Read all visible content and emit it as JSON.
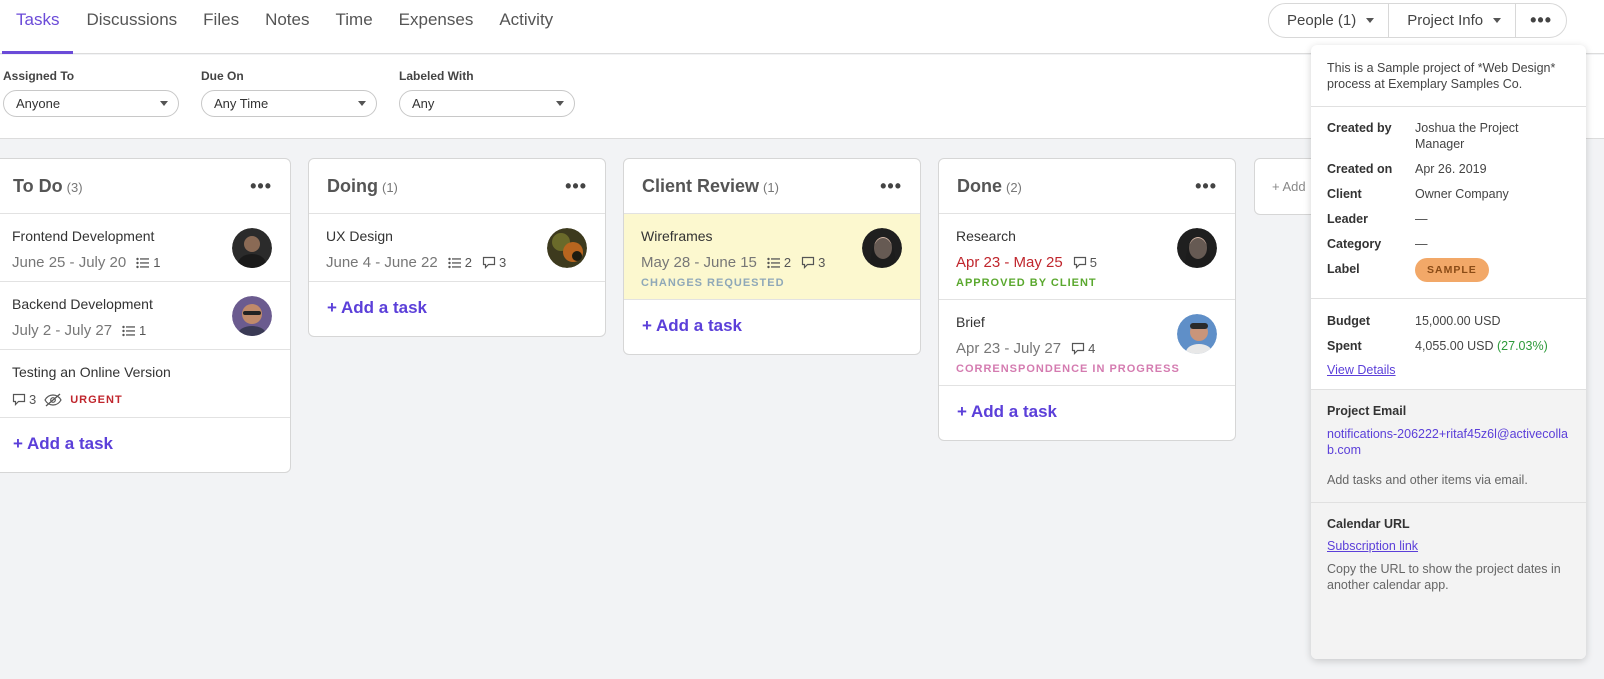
{
  "tabs": [
    "Tasks",
    "Discussions",
    "Files",
    "Notes",
    "Time",
    "Expenses",
    "Activity"
  ],
  "header": {
    "people_label": "People (1)",
    "project_info_label": "Project Info",
    "more_label": "•••"
  },
  "filters": [
    {
      "label": "Assigned To",
      "value": "Anyone"
    },
    {
      "label": "Due On",
      "value": "Any Time"
    },
    {
      "label": "Labeled With",
      "value": "Any"
    }
  ],
  "columns": {
    "todo": {
      "title": "To Do",
      "count": "(3)",
      "dots": "•••",
      "add": "+ Add a task",
      "tasks": [
        {
          "name": "Frontend Development",
          "date": "June 25 - July 20",
          "subtasks": "1"
        },
        {
          "name": "Backend Development",
          "date": "July 2 - July 27",
          "subtasks": "1"
        },
        {
          "name": "Testing an Online Version",
          "comments": "3",
          "tag": "URGENT"
        }
      ]
    },
    "doing": {
      "title": "Doing",
      "count": "(1)",
      "dots": "•••",
      "add": "+ Add a task",
      "tasks": [
        {
          "name": "UX Design",
          "date": "June 4 - June 22",
          "subtasks": "2",
          "comments": "3"
        }
      ]
    },
    "review": {
      "title": "Client Review",
      "count": "(1)",
      "dots": "•••",
      "add": "+ Add a task",
      "tasks": [
        {
          "name": "Wireframes",
          "date": "May 28 - June 15",
          "subtasks": "2",
          "comments": "3",
          "status": "CHANGES REQUESTED"
        }
      ]
    },
    "done": {
      "title": "Done",
      "count": "(2)",
      "dots": "•••",
      "add": "+ Add a task",
      "tasks": [
        {
          "name": "Research",
          "date": "Apr 23 - May 25",
          "comments": "5",
          "status": "APPROVED BY CLIENT"
        },
        {
          "name": "Brief",
          "date": "Apr 23 - July 27",
          "comments": "4",
          "status": "CORRENSPONDENCE IN PROGRESS"
        }
      ]
    },
    "ghost": {
      "label": "+ Add"
    }
  },
  "project_info": {
    "description": "This is a Sample project of *Web Design* process at Exemplary Samples Co.",
    "rows": [
      {
        "k": "Created by",
        "v": "Joshua the Project Manager"
      },
      {
        "k": "Created on",
        "v": "Apr 26. 2019"
      },
      {
        "k": "Client",
        "v": "Owner Company"
      },
      {
        "k": "Leader",
        "v": "—"
      },
      {
        "k": "Category",
        "v": "—"
      }
    ],
    "label_key": "Label",
    "label_value": "SAMPLE",
    "budget_key": "Budget",
    "budget_value": "15,000.00 USD",
    "spent_key": "Spent",
    "spent_value": "4,055.00 USD",
    "spent_pct": "(27.03%)",
    "view_details": "View Details",
    "email_heading": "Project Email",
    "email": "notifications-206222+ritaf45z6l@activecollab.com",
    "email_note": "Add tasks and other items via email.",
    "calendar_heading": "Calendar URL",
    "calendar_link": "Subscription link",
    "calendar_note": "Copy the URL to show the project dates in another calendar app."
  },
  "colors": {
    "accent": "#6b4bd8",
    "link": "#5b3fd9",
    "urgent": "#c0262d",
    "changes_requested": "#8fa8b8",
    "approved": "#5aa82e",
    "in_progress": "#d47bb0",
    "sample_badge": "#f2a868",
    "highlight_card": "#fcf8cf"
  }
}
